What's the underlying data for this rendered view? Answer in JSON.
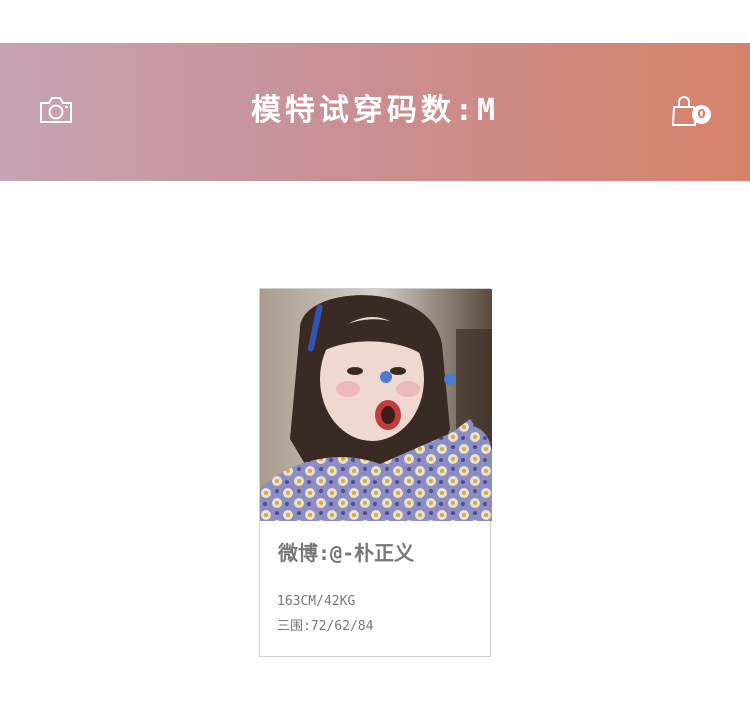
{
  "header": {
    "title": "模特试穿码数:M",
    "camera_icon": "camera-icon",
    "cart_icon": "shopping-bag-icon",
    "cart_count": "0",
    "gradient_start": "#c6a3b3",
    "gradient_end": "#d6826a"
  },
  "model_card": {
    "photo": "model-photo",
    "name": "微博:@-朴正义",
    "height_weight": "163CM/42KG",
    "measurements": "三围:72/62/84"
  }
}
